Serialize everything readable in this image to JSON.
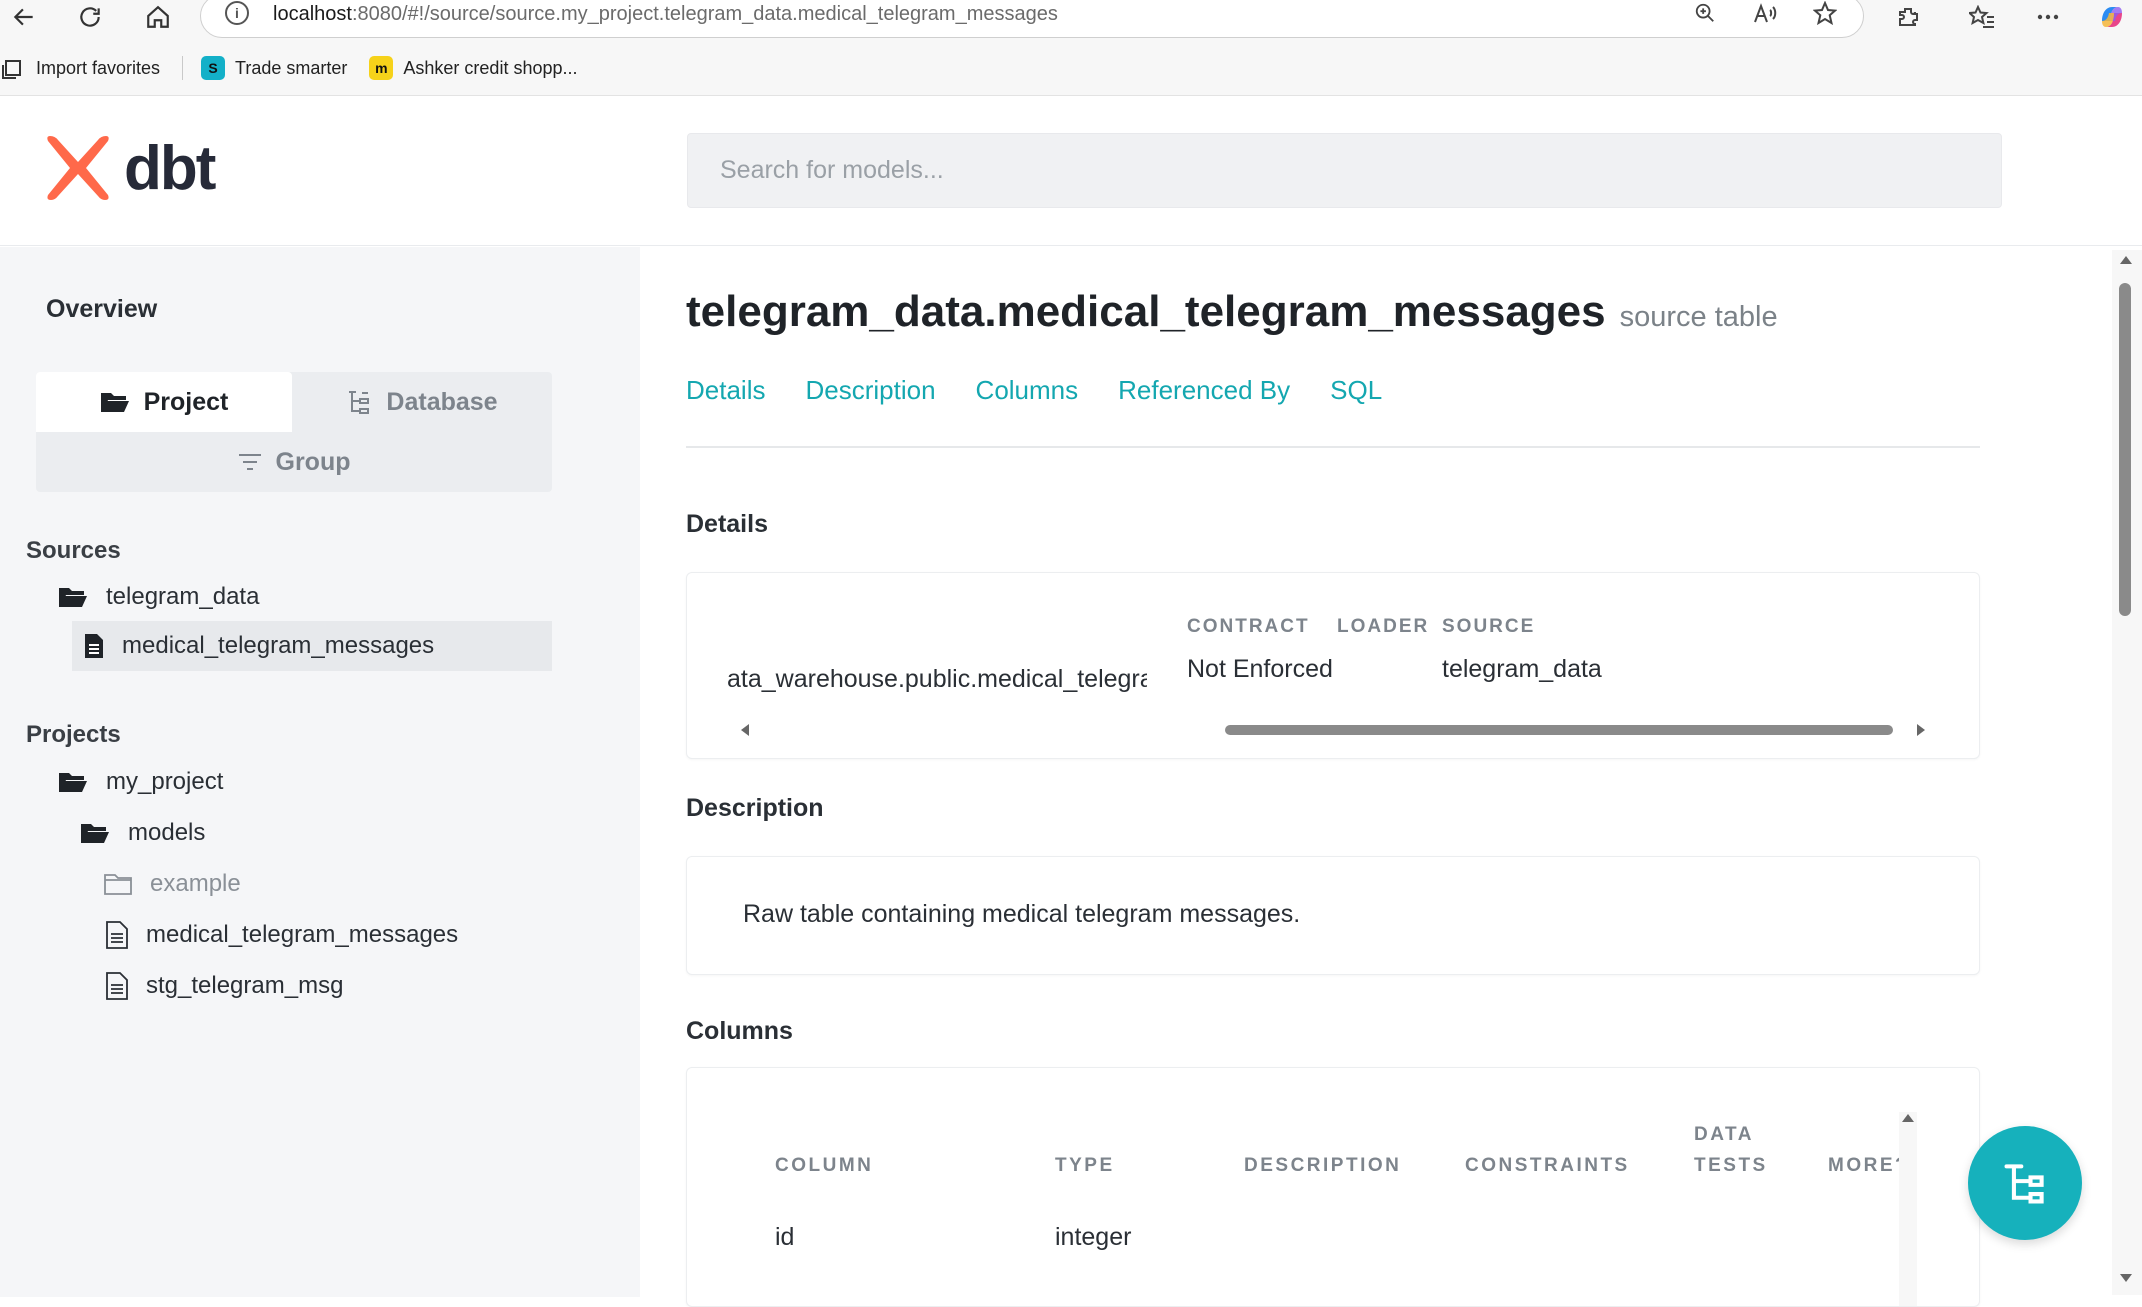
{
  "browser": {
    "url_host": "localhost",
    "url_rest": ":8080/#!/source/source.my_project.telegram_data.medical_telegram_messages",
    "favorites": [
      {
        "label": "Import favorites"
      },
      {
        "label": "Trade smarter"
      },
      {
        "label": "Ashker credit shopp..."
      }
    ]
  },
  "header": {
    "logo_text": "dbt",
    "search_placeholder": "Search for models..."
  },
  "sidebar": {
    "overview": "Overview",
    "tabs": {
      "project": "Project",
      "database": "Database",
      "group": "Group"
    },
    "sources_heading": "Sources",
    "sources": [
      {
        "label": "telegram_data"
      },
      {
        "label": "medical_telegram_messages"
      }
    ],
    "projects_heading": "Projects",
    "projects": [
      {
        "label": "my_project"
      },
      {
        "label": "models"
      },
      {
        "label": "example"
      },
      {
        "label": "medical_telegram_messages"
      },
      {
        "label": "stg_telegram_msg"
      }
    ]
  },
  "main": {
    "title": "telegram_data.medical_telegram_messages",
    "subtitle": "source table",
    "anchors": [
      "Details",
      "Description",
      "Columns",
      "Referenced By",
      "SQL"
    ],
    "details": {
      "heading": "Details",
      "relation_value": "ata_warehouse.public.medical_telegram_messages",
      "contract_label": "CONTRACT",
      "contract_value": "Not Enforced",
      "loader_label": "LOADER",
      "loader_value": "",
      "source_label": "SOURCE",
      "source_value": "telegram_data"
    },
    "description": {
      "heading": "Description",
      "text": "Raw table containing medical telegram messages."
    },
    "columns": {
      "heading": "Columns",
      "headers": [
        "COLUMN",
        "TYPE",
        "DESCRIPTION",
        "CONSTRAINTS",
        "DATA TESTS",
        "MORE?"
      ],
      "rows": [
        {
          "column": "id",
          "type": "integer"
        }
      ]
    }
  },
  "colors": {
    "accent": "#14a7b0",
    "fab": "#16b1bc",
    "logo_orange": "#ff694a"
  }
}
